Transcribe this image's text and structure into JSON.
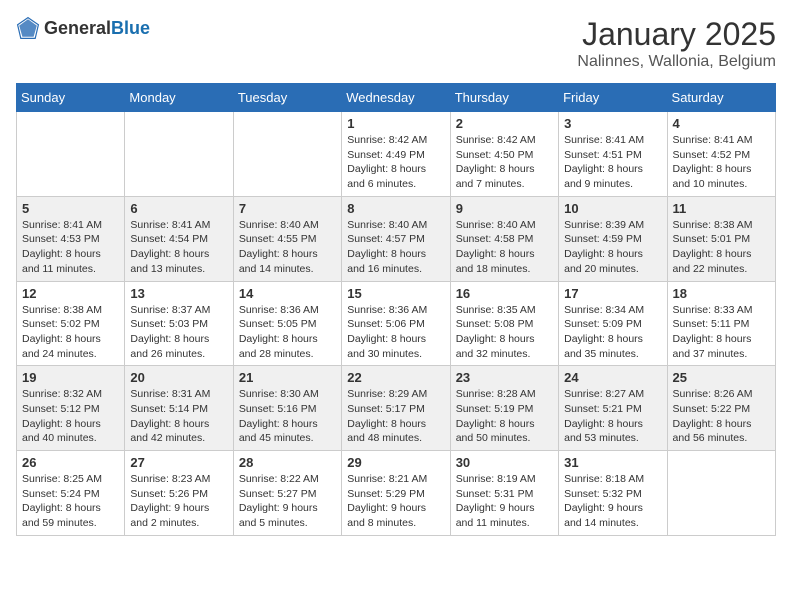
{
  "logo": {
    "general": "General",
    "blue": "Blue"
  },
  "header": {
    "month": "January 2025",
    "location": "Nalinnes, Wallonia, Belgium"
  },
  "weekdays": [
    "Sunday",
    "Monday",
    "Tuesday",
    "Wednesday",
    "Thursday",
    "Friday",
    "Saturday"
  ],
  "weeks": [
    [
      {
        "day": "",
        "info": ""
      },
      {
        "day": "",
        "info": ""
      },
      {
        "day": "",
        "info": ""
      },
      {
        "day": "1",
        "info": "Sunrise: 8:42 AM\nSunset: 4:49 PM\nDaylight: 8 hours and 6 minutes."
      },
      {
        "day": "2",
        "info": "Sunrise: 8:42 AM\nSunset: 4:50 PM\nDaylight: 8 hours and 7 minutes."
      },
      {
        "day": "3",
        "info": "Sunrise: 8:41 AM\nSunset: 4:51 PM\nDaylight: 8 hours and 9 minutes."
      },
      {
        "day": "4",
        "info": "Sunrise: 8:41 AM\nSunset: 4:52 PM\nDaylight: 8 hours and 10 minutes."
      }
    ],
    [
      {
        "day": "5",
        "info": "Sunrise: 8:41 AM\nSunset: 4:53 PM\nDaylight: 8 hours and 11 minutes."
      },
      {
        "day": "6",
        "info": "Sunrise: 8:41 AM\nSunset: 4:54 PM\nDaylight: 8 hours and 13 minutes."
      },
      {
        "day": "7",
        "info": "Sunrise: 8:40 AM\nSunset: 4:55 PM\nDaylight: 8 hours and 14 minutes."
      },
      {
        "day": "8",
        "info": "Sunrise: 8:40 AM\nSunset: 4:57 PM\nDaylight: 8 hours and 16 minutes."
      },
      {
        "day": "9",
        "info": "Sunrise: 8:40 AM\nSunset: 4:58 PM\nDaylight: 8 hours and 18 minutes."
      },
      {
        "day": "10",
        "info": "Sunrise: 8:39 AM\nSunset: 4:59 PM\nDaylight: 8 hours and 20 minutes."
      },
      {
        "day": "11",
        "info": "Sunrise: 8:38 AM\nSunset: 5:01 PM\nDaylight: 8 hours and 22 minutes."
      }
    ],
    [
      {
        "day": "12",
        "info": "Sunrise: 8:38 AM\nSunset: 5:02 PM\nDaylight: 8 hours and 24 minutes."
      },
      {
        "day": "13",
        "info": "Sunrise: 8:37 AM\nSunset: 5:03 PM\nDaylight: 8 hours and 26 minutes."
      },
      {
        "day": "14",
        "info": "Sunrise: 8:36 AM\nSunset: 5:05 PM\nDaylight: 8 hours and 28 minutes."
      },
      {
        "day": "15",
        "info": "Sunrise: 8:36 AM\nSunset: 5:06 PM\nDaylight: 8 hours and 30 minutes."
      },
      {
        "day": "16",
        "info": "Sunrise: 8:35 AM\nSunset: 5:08 PM\nDaylight: 8 hours and 32 minutes."
      },
      {
        "day": "17",
        "info": "Sunrise: 8:34 AM\nSunset: 5:09 PM\nDaylight: 8 hours and 35 minutes."
      },
      {
        "day": "18",
        "info": "Sunrise: 8:33 AM\nSunset: 5:11 PM\nDaylight: 8 hours and 37 minutes."
      }
    ],
    [
      {
        "day": "19",
        "info": "Sunrise: 8:32 AM\nSunset: 5:12 PM\nDaylight: 8 hours and 40 minutes."
      },
      {
        "day": "20",
        "info": "Sunrise: 8:31 AM\nSunset: 5:14 PM\nDaylight: 8 hours and 42 minutes."
      },
      {
        "day": "21",
        "info": "Sunrise: 8:30 AM\nSunset: 5:16 PM\nDaylight: 8 hours and 45 minutes."
      },
      {
        "day": "22",
        "info": "Sunrise: 8:29 AM\nSunset: 5:17 PM\nDaylight: 8 hours and 48 minutes."
      },
      {
        "day": "23",
        "info": "Sunrise: 8:28 AM\nSunset: 5:19 PM\nDaylight: 8 hours and 50 minutes."
      },
      {
        "day": "24",
        "info": "Sunrise: 8:27 AM\nSunset: 5:21 PM\nDaylight: 8 hours and 53 minutes."
      },
      {
        "day": "25",
        "info": "Sunrise: 8:26 AM\nSunset: 5:22 PM\nDaylight: 8 hours and 56 minutes."
      }
    ],
    [
      {
        "day": "26",
        "info": "Sunrise: 8:25 AM\nSunset: 5:24 PM\nDaylight: 8 hours and 59 minutes."
      },
      {
        "day": "27",
        "info": "Sunrise: 8:23 AM\nSunset: 5:26 PM\nDaylight: 9 hours and 2 minutes."
      },
      {
        "day": "28",
        "info": "Sunrise: 8:22 AM\nSunset: 5:27 PM\nDaylight: 9 hours and 5 minutes."
      },
      {
        "day": "29",
        "info": "Sunrise: 8:21 AM\nSunset: 5:29 PM\nDaylight: 9 hours and 8 minutes."
      },
      {
        "day": "30",
        "info": "Sunrise: 8:19 AM\nSunset: 5:31 PM\nDaylight: 9 hours and 11 minutes."
      },
      {
        "day": "31",
        "info": "Sunrise: 8:18 AM\nSunset: 5:32 PM\nDaylight: 9 hours and 14 minutes."
      },
      {
        "day": "",
        "info": ""
      }
    ]
  ]
}
